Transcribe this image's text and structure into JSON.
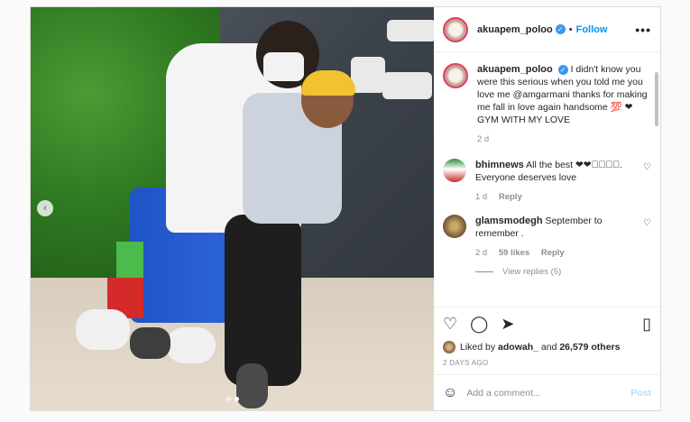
{
  "post": {
    "username": "akuapem_poloo",
    "follow_label": "Follow",
    "separator": "•",
    "more_label": "•••",
    "verified_mark": "✓"
  },
  "caption": {
    "username": "akuapem_poloo",
    "text": "I didn't know you were this serious when you told me you love me @amgarmani thanks for making me fall in love again handsome 💯 ❤ GYM WITH MY LOVE",
    "age": "2 d"
  },
  "comments": [
    {
      "username": "bhimnews",
      "text": "All the best ❤❤❤🏿🏿🏿. Everyone deserves love",
      "age": "1 d",
      "likes": "",
      "reply_label": "Reply"
    },
    {
      "username": "glamsmodegh",
      "text": "September to remember .",
      "age": "2 d",
      "likes": "59 likes",
      "reply_label": "Reply",
      "view_replies": "View replies (5)"
    }
  ],
  "likes": {
    "prefix": "Liked by",
    "user": "adowah_",
    "middle": "and",
    "others": "26,579 others"
  },
  "post_date": "2 DAYS AGO",
  "add_comment": {
    "placeholder": "Add a comment...",
    "post_label": "Post"
  },
  "icons": {
    "carousel_prev": "‹",
    "heart": "♡",
    "comment": "◯",
    "share": "➤",
    "bookmark": "▯",
    "emoji": "☺"
  }
}
